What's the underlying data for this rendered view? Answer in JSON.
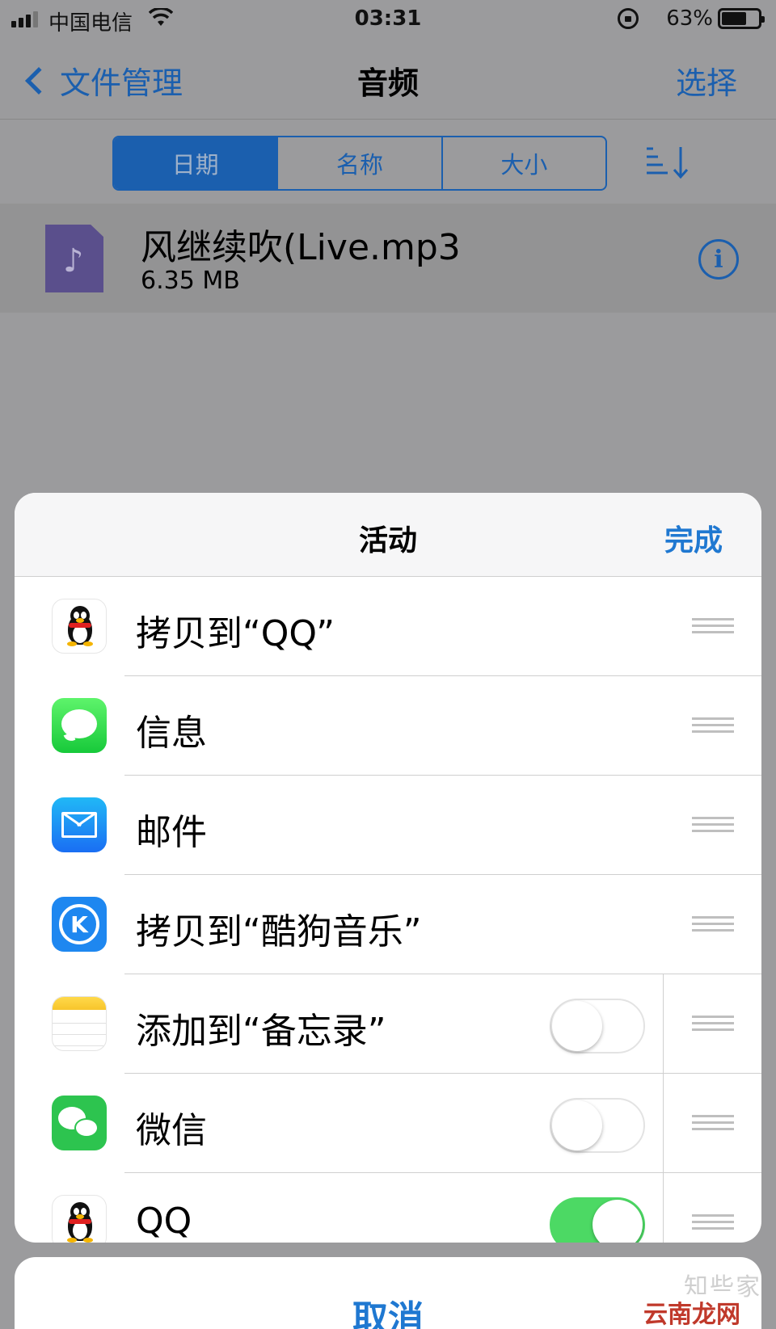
{
  "status_bar": {
    "carrier": "中国电信",
    "time": "03:31",
    "battery": "63%",
    "battery_level": 0.63
  },
  "nav": {
    "back_label": "文件管理",
    "title": "音频",
    "select_label": "选择"
  },
  "sort_tabs": [
    {
      "label": "日期",
      "active": true
    },
    {
      "label": "名称",
      "active": false
    },
    {
      "label": "大小",
      "active": false
    }
  ],
  "file": {
    "name": "风继续吹(Live.mp3",
    "size": "6.35 MB"
  },
  "sheet": {
    "title": "活动",
    "done_label": "完成",
    "items": [
      {
        "label": "拷贝到“QQ”",
        "icon": "qq-icon",
        "toggle": null
      },
      {
        "label": "信息",
        "icon": "messages-icon",
        "toggle": null
      },
      {
        "label": "邮件",
        "icon": "mail-icon",
        "toggle": null
      },
      {
        "label": "拷贝到“酷狗音乐”",
        "icon": "kugou-icon",
        "toggle": null
      },
      {
        "label": "添加到“备忘录”",
        "icon": "notes-icon",
        "toggle": false
      },
      {
        "label": "微信",
        "icon": "wechat-icon",
        "toggle": false
      },
      {
        "label": "QQ",
        "icon": "qq-icon",
        "toggle": true
      }
    ]
  },
  "cancel_label": "取消",
  "watermark": {
    "line1": "知些家",
    "line2": "云南龙网"
  },
  "colors": {
    "accent": "#1f78d1",
    "toggle_on": "#4cd964"
  }
}
